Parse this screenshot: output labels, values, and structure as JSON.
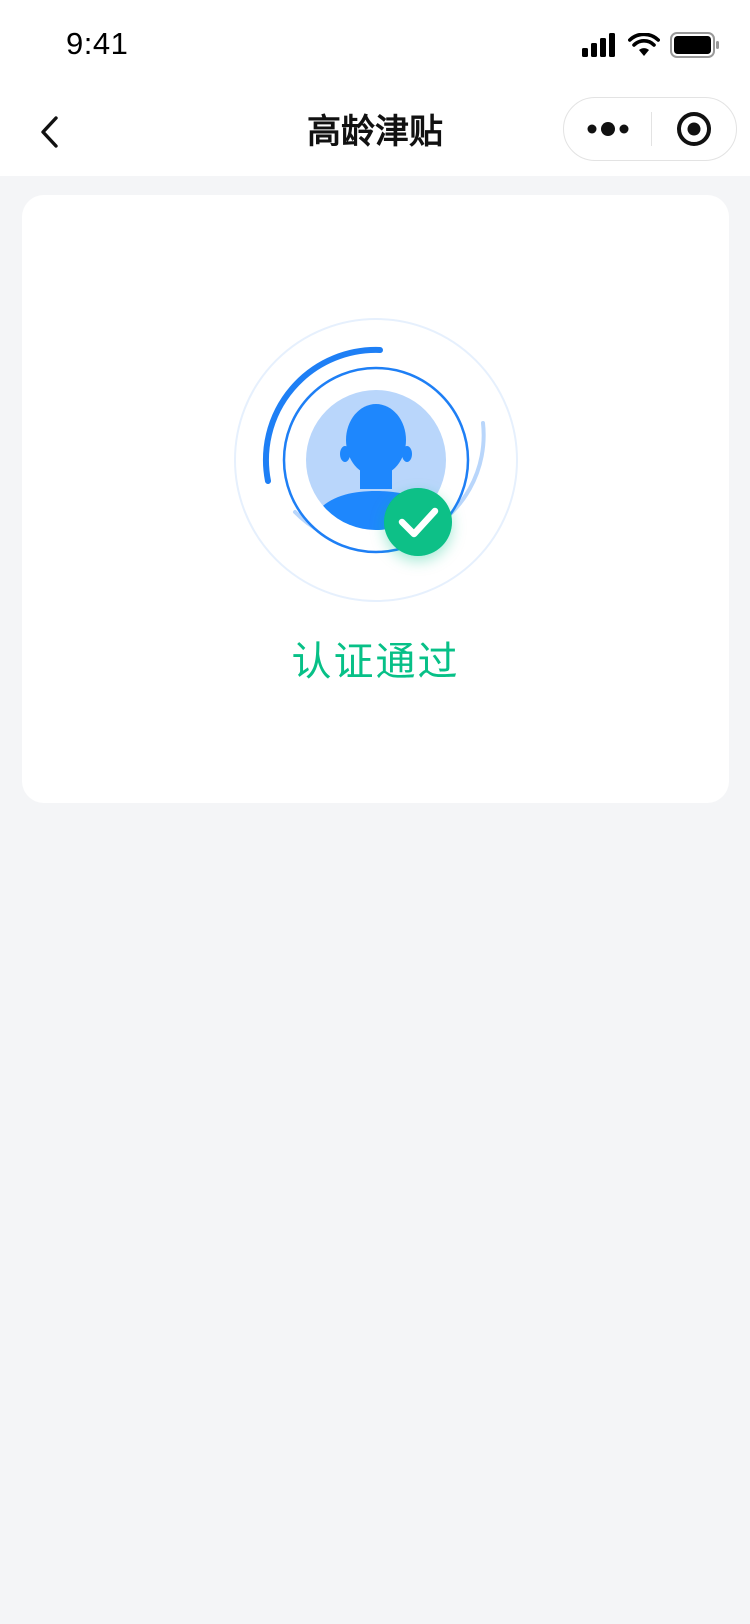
{
  "status_bar": {
    "time": "9:41",
    "icons": [
      "cellular-signal-icon",
      "wifi-icon",
      "battery-icon"
    ]
  },
  "nav": {
    "title": "高龄津贴",
    "back_icon": "chevron-left-icon",
    "capsule": {
      "more_icon": "more-dots-icon",
      "close_icon": "target-close-icon"
    }
  },
  "card": {
    "graphic_icons": [
      "person-silhouette-icon",
      "check-circle-icon"
    ],
    "result_text": "认证通过"
  },
  "colors": {
    "page_background": "#f4f5f7",
    "accent_blue": "#1e7ff5",
    "light_blue": "#b9d6fb",
    "success_green": "#07c087"
  }
}
